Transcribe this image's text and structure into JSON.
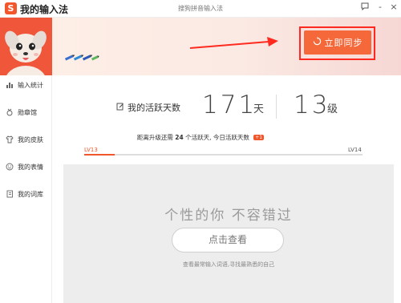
{
  "app": {
    "logo_letter": "S",
    "title": "我的输入法",
    "window_caption": "搜狗拼音输入法"
  },
  "window_controls": {
    "menu_icon": "speech-bubble-icon",
    "minimize": "-",
    "close": "×"
  },
  "header": {
    "sync_button_label": "立即同步",
    "sync_icon": "refresh-circle-icon",
    "brand_color": "#f2562b"
  },
  "sidebar": {
    "items": [
      {
        "label": "输入统计",
        "icon": "bar-chart-icon"
      },
      {
        "label": "勋章馆",
        "icon": "medal-icon"
      },
      {
        "label": "我的皮肤",
        "icon": "shirt-icon"
      },
      {
        "label": "我的表情",
        "icon": "smiley-icon"
      },
      {
        "label": "我的词库",
        "icon": "dictionary-icon"
      }
    ]
  },
  "stats": {
    "active_days_label": "我的活跃天数",
    "active_days": "171",
    "days_unit": "天",
    "level": "13",
    "level_unit": "级"
  },
  "upgrade": {
    "prefix": "距离升级还需",
    "days_needed": "24",
    "middle": "个活跃天,",
    "today_label": "今日活跃天数",
    "today_badge": "+1"
  },
  "level_progress": {
    "current": "LV13",
    "next": "LV14",
    "fraction": 0.11
  },
  "promo": {
    "slogan": "个性的你 不容错过",
    "button_label": "点击查看",
    "subtitle": "查看最常输入词语,寻找最熟悉的自己"
  }
}
